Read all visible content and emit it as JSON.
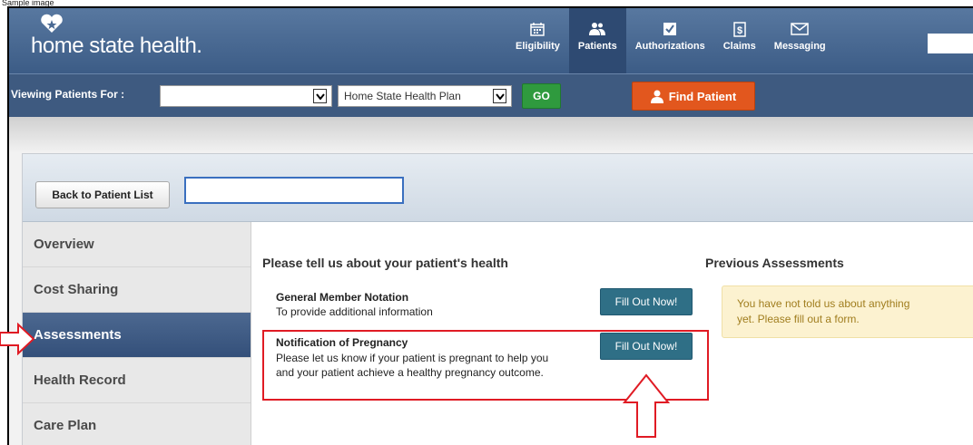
{
  "header": {
    "logo_text": "home state health.",
    "nav": [
      {
        "label": "Eligibility",
        "icon": "calendar-icon",
        "active": false
      },
      {
        "label": "Patients",
        "icon": "patients-icon",
        "active": true
      },
      {
        "label": "Authorizations",
        "icon": "checkmark-icon",
        "active": false
      },
      {
        "label": "Claims",
        "icon": "dollar-document-icon",
        "active": false
      },
      {
        "label": "Messaging",
        "icon": "envelope-icon",
        "active": false
      }
    ]
  },
  "subbar": {
    "viewing_label": "Viewing Patients For :",
    "provider_select_value": "",
    "plan_select_value": "Home State Health Plan",
    "go_label": "GO",
    "find_patient_label": "Find Patient"
  },
  "panel": {
    "back_label": "Back to Patient List",
    "search_value": ""
  },
  "sidebar": {
    "items": [
      {
        "label": "Overview",
        "active": false
      },
      {
        "label": "Cost Sharing",
        "active": false
      },
      {
        "label": "Assessments",
        "active": true
      },
      {
        "label": "Health Record",
        "active": false
      },
      {
        "label": "Care Plan",
        "active": false
      }
    ]
  },
  "assessments": {
    "heading": "Please tell us about your patient's health",
    "items": [
      {
        "title": "General Member Notation",
        "description": "To provide additional information",
        "button": "Fill Out Now!"
      },
      {
        "title": "Notification of Pregnancy",
        "description_line1": "Please let us know if your patient is pregnant to help you",
        "description_line2": "and your patient achieve a healthy pregnancy outcome.",
        "button": "Fill Out Now!"
      }
    ]
  },
  "previous": {
    "heading": "Previous Assessments",
    "notice_line1": "You have not told us about anything",
    "notice_line2": "yet. Please fill out a form."
  },
  "colors": {
    "header": "#3c5c86",
    "go": "#2f9a3e",
    "find_patient": "#e2571e",
    "fill_button": "#2f6f86",
    "annotation": "#e01b24",
    "notice_bg": "#fcf2d0"
  }
}
